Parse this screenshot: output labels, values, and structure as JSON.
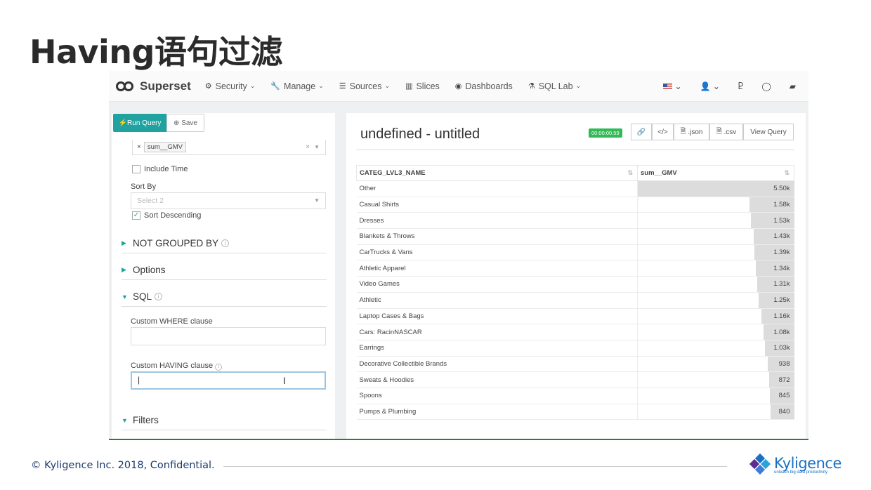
{
  "slide_title": "Having语句过滤",
  "navbar": {
    "brand": "Superset",
    "items": [
      {
        "icon": "cogs-icon",
        "label": "Security",
        "caret": true
      },
      {
        "icon": "wrench-icon",
        "label": "Manage",
        "caret": true
      },
      {
        "icon": "database-icon",
        "label": "Sources",
        "caret": true
      },
      {
        "icon": "bar-chart-icon",
        "label": "Slices",
        "caret": false
      },
      {
        "icon": "dashboard-icon",
        "label": "Dashboards",
        "caret": false
      },
      {
        "icon": "flask-icon",
        "label": "SQL Lab",
        "caret": true
      }
    ]
  },
  "explore": {
    "run_query_label": "Run Query",
    "save_label": "Save",
    "metric_tag": "sum__GMV",
    "include_time_label": "Include Time",
    "sort_by_label": "Sort By",
    "sort_by_placeholder": "Select 2",
    "sort_descending_label": "Sort Descending",
    "sections": {
      "not_grouped_by": "NOT GROUPED BY",
      "options": "Options",
      "sql": "SQL",
      "filters": "Filters"
    },
    "custom_where_label": "Custom WHERE clause",
    "custom_having_label": "Custom HAVING clause",
    "custom_having_value": "|"
  },
  "results": {
    "title": "undefined - untitled",
    "timer": "00:00:00.59",
    "buttons": {
      "json": ".json",
      "csv": ".csv",
      "view_query": "View Query"
    },
    "columns": [
      "CATEG_LVL3_NAME",
      "sum__GMV"
    ],
    "max_value": 5500,
    "rows": [
      {
        "name": "Other",
        "display": "5.50k",
        "value": 5500
      },
      {
        "name": "Casual Shirts",
        "display": "1.58k",
        "value": 1580
      },
      {
        "name": "Dresses",
        "display": "1.53k",
        "value": 1530
      },
      {
        "name": "Blankets & Throws",
        "display": "1.43k",
        "value": 1430
      },
      {
        "name": "CarTrucks & Vans",
        "display": "1.39k",
        "value": 1390
      },
      {
        "name": "Athletic Apparel",
        "display": "1.34k",
        "value": 1340
      },
      {
        "name": "Video Games",
        "display": "1.31k",
        "value": 1310
      },
      {
        "name": "Athletic",
        "display": "1.25k",
        "value": 1250
      },
      {
        "name": "Laptop Cases & Bags",
        "display": "1.16k",
        "value": 1160
      },
      {
        "name": "Cars: RacinNASCAR",
        "display": "1.08k",
        "value": 1080
      },
      {
        "name": "Earrings",
        "display": "1.03k",
        "value": 1030
      },
      {
        "name": "Decorative Collectible Brands",
        "display": "938",
        "value": 938
      },
      {
        "name": "Sweats & Hoodies",
        "display": "872",
        "value": 872
      },
      {
        "name": "Spoons",
        "display": "845",
        "value": 845
      },
      {
        "name": "Pumps & Plumbing",
        "display": "840",
        "value": 840
      }
    ]
  },
  "footer": {
    "copyright": "© Kyligence Inc. 2018, Confidential.",
    "logo_name": "Kyligence",
    "logo_tagline": "unleash big data productivity"
  },
  "colors": {
    "accent": "#1fa2a0",
    "timer": "#33b955",
    "brand_blue": "#1a6fc4"
  }
}
